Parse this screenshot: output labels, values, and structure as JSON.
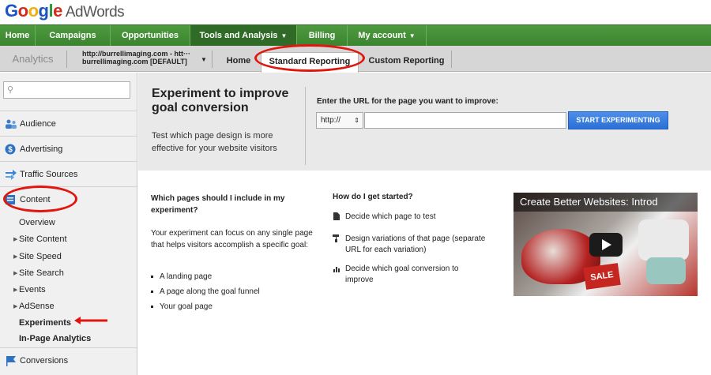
{
  "logo": {
    "google": "Google",
    "product": "AdWords"
  },
  "top_nav": {
    "items": [
      {
        "label": "Home"
      },
      {
        "label": "Campaigns"
      },
      {
        "label": "Opportunities"
      },
      {
        "label": "Tools and Analysis",
        "dropdown": true,
        "active": true
      },
      {
        "label": "Billing"
      },
      {
        "label": "My account",
        "dropdown": true
      }
    ]
  },
  "sub_nav": {
    "analytics": "Analytics",
    "account_line1": "http://burrellimaging.com - htt···",
    "account_line2": "burrellimaging.com [DEFAULT]",
    "tabs": [
      {
        "label": "Home"
      },
      {
        "label": "Standard Reporting",
        "active": true
      },
      {
        "label": "Custom Reporting"
      }
    ]
  },
  "sidebar": {
    "search_placeholder": "",
    "sections": [
      {
        "label": "Audience",
        "icon": "people-icon"
      },
      {
        "label": "Advertising",
        "icon": "dollar-icon"
      },
      {
        "label": "Traffic Sources",
        "icon": "arrows-icon"
      },
      {
        "label": "Content",
        "icon": "page-icon"
      }
    ],
    "content_items": [
      {
        "label": "Overview",
        "expandable": false
      },
      {
        "label": "Site Content",
        "expandable": true
      },
      {
        "label": "Site Speed",
        "expandable": true
      },
      {
        "label": "Site Search",
        "expandable": true
      },
      {
        "label": "Events",
        "expandable": true
      },
      {
        "label": "AdSense",
        "expandable": true
      },
      {
        "label": "Experiments",
        "expandable": false,
        "selected": true
      },
      {
        "label": "In-Page Analytics",
        "expandable": false
      }
    ],
    "bottom_section": {
      "label": "Conversions",
      "icon": "flag-icon"
    }
  },
  "banner": {
    "title": "Experiment to improve goal conversion",
    "description": "Test which page design is more effective for your website visitors",
    "url_label": "Enter the URL for the page you want to improve:",
    "protocol": "http://",
    "url_value": "",
    "start_button": "START EXPERIMENTING"
  },
  "info": {
    "q1": "Which pages should I include in my experiment?",
    "p1": "Your experiment can focus on any single page that helps visitors accomplish a specific goal:",
    "bullets": [
      "A landing page",
      "A page along the goal funnel",
      "Your goal page"
    ],
    "q2": "How do I get started?",
    "steps": [
      {
        "text": "Decide which page to test",
        "icon": "document-icon"
      },
      {
        "text": "Design variations of that page (separate URL for each variation)",
        "icon": "paint-roller-icon"
      },
      {
        "text": "Decide which goal conversion to improve",
        "icon": "bar-chart-icon"
      }
    ]
  },
  "video": {
    "title": "Create Better Websites: Introd",
    "sale_text": "SALE"
  },
  "colors": {
    "annotation": "#e0160f",
    "nav_green": "#4f9a3f",
    "button_blue": "#2a6fd6"
  }
}
